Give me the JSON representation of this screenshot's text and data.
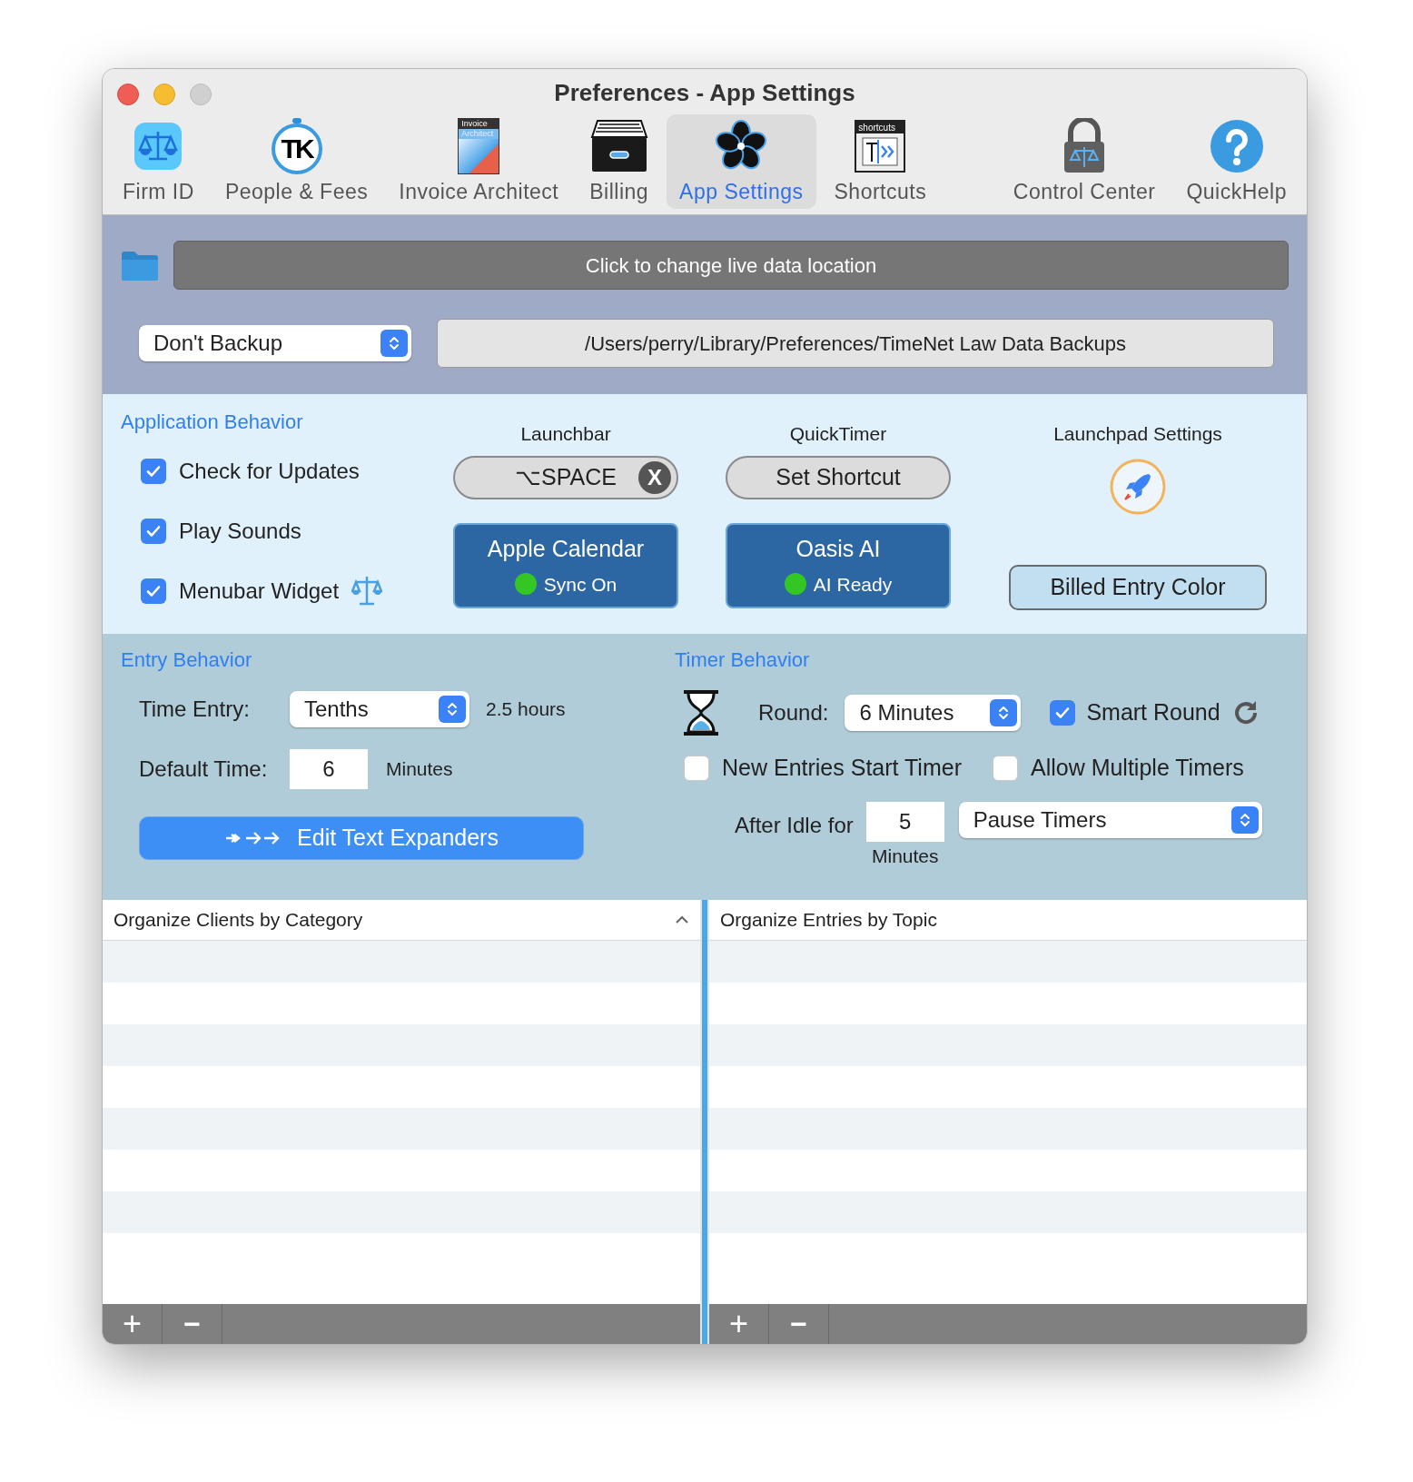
{
  "window": {
    "title": "Preferences - App Settings"
  },
  "toolbar": {
    "items": [
      {
        "kind": "scales",
        "label": "Firm ID",
        "selected": false
      },
      {
        "kind": "tk",
        "label": "People & Fees",
        "selected": false,
        "icon_text": "TK"
      },
      {
        "kind": "invoice",
        "label": "Invoice Architect",
        "selected": false,
        "icon_text": [
          "Invoice",
          "Architect"
        ]
      },
      {
        "kind": "drawer",
        "label": "Billing",
        "selected": false
      },
      {
        "kind": "flower",
        "label": "App Settings",
        "selected": true
      },
      {
        "kind": "shortcuts",
        "label": "Shortcuts",
        "selected": false,
        "icon_text": "shortcuts"
      },
      {
        "kind": "lock",
        "label": "Control Center",
        "selected": false
      },
      {
        "kind": "help",
        "label": "QuickHelp",
        "selected": false
      }
    ]
  },
  "data_location": {
    "button": "Click to change live data location"
  },
  "backup": {
    "select": "Don't Backup",
    "path": "/Users/perry/Library/Preferences/TimeNet Law Data Backups"
  },
  "app_behavior": {
    "heading": "Application Behavior",
    "checkboxes": [
      {
        "label": "Check for Updates",
        "checked": true
      },
      {
        "label": "Play Sounds",
        "checked": true
      },
      {
        "label": "Menubar Widget",
        "checked": true
      }
    ],
    "launchbar": {
      "label": "Launchbar",
      "shortcut": "⌥SPACE",
      "clear": "X"
    },
    "quicktimer": {
      "label": "QuickTimer",
      "button": "Set Shortcut"
    },
    "services": [
      {
        "title": "Apple Calendar",
        "status": "Sync On",
        "color": "#34c724"
      },
      {
        "title": "Oasis AI",
        "status": "AI Ready",
        "color": "#34c724"
      }
    ],
    "launchpad": {
      "label": "Launchpad Settings"
    },
    "billed_entry_color": "Billed Entry Color"
  },
  "entry_behavior": {
    "heading": "Entry Behavior",
    "time_entry_label": "Time Entry:",
    "time_entry": "Tenths",
    "time_entry_hint": "2.5 hours",
    "default_time_label": "Default Time:",
    "default_time": "6",
    "default_time_unit": "Minutes",
    "expanders_button": "Edit Text Expanders"
  },
  "timer_behavior": {
    "heading": "Timer Behavior",
    "round_label": "Round:",
    "round": "6 Minutes",
    "checkboxes": [
      {
        "label": "Smart Round",
        "checked": true
      },
      {
        "label": "New Entries Start Timer",
        "checked": false
      },
      {
        "label": "Allow Multiple Timers",
        "checked": false
      }
    ],
    "idle_label": "After Idle for",
    "idle": "5",
    "idle_unit": "Minutes",
    "idle_action": "Pause Timers"
  },
  "tables": [
    {
      "heading": "Organize Clients by Category",
      "sorted": true,
      "add": "+",
      "remove": "−"
    },
    {
      "heading": "Organize Entries by Topic",
      "sorted": false,
      "add": "+",
      "remove": "−"
    }
  ]
}
